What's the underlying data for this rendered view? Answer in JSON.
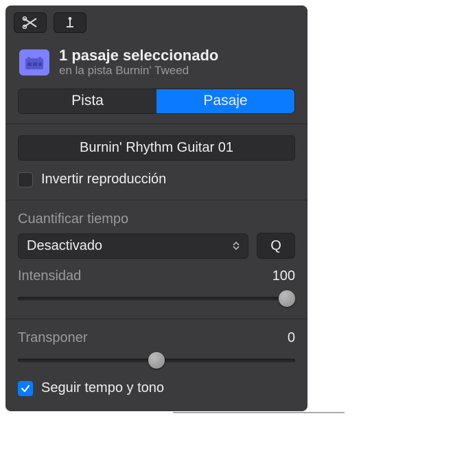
{
  "header": {
    "title": "1 pasaje seleccionado",
    "subtitle": "en la pista Burnin' Tweed"
  },
  "tabs": {
    "track": "Pista",
    "region": "Pasaje"
  },
  "region": {
    "name": "Burnin' Rhythm Guitar 01",
    "reverse_label": "Invertir reproducción",
    "reverse_checked": false
  },
  "quantize": {
    "label": "Cuantificar tiempo",
    "value": "Desactivado",
    "q_button": "Q",
    "strength_label": "Intensidad",
    "strength_value": "100",
    "strength_pct": 100
  },
  "transpose": {
    "label": "Transponer",
    "value": "0",
    "slider_pct": 50,
    "follow_label": "Seguir tempo y tono",
    "follow_checked": true
  }
}
